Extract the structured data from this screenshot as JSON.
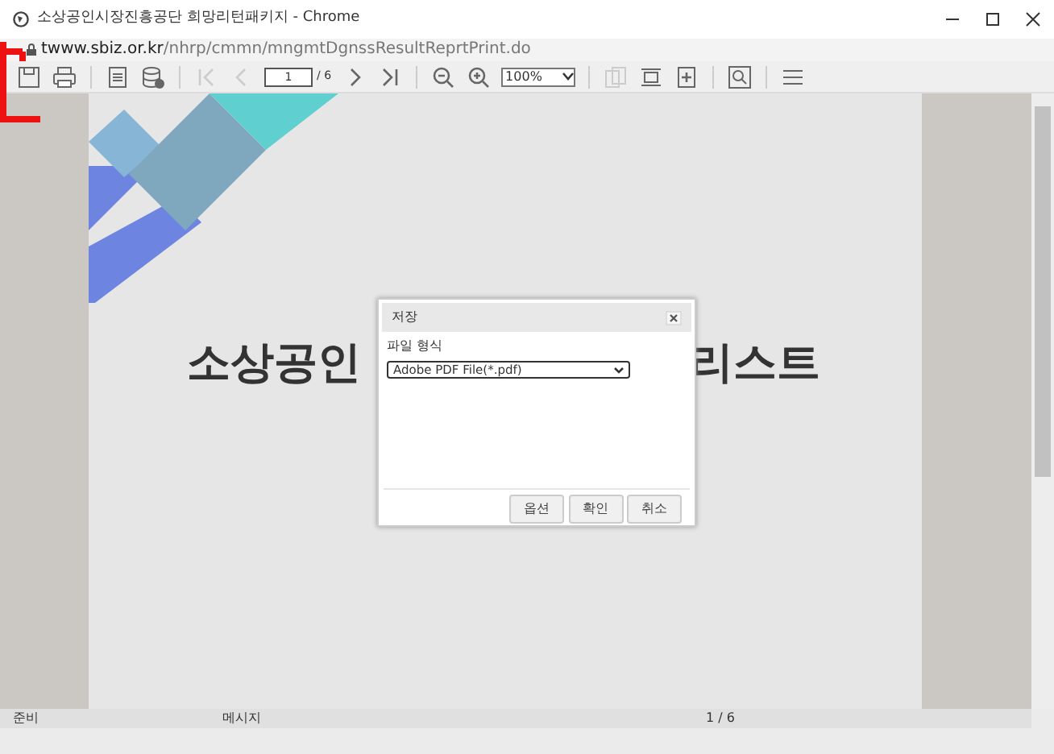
{
  "window": {
    "title": "소상공인시장진흥공단 희망리턴패키지 - Chrome"
  },
  "address": {
    "host": "twww.sbiz.or.kr",
    "path": "/nhrp/cmmn/mngmtDgnssResultReprtPrint.do"
  },
  "toolbar": [
    {
      "kind": "save",
      "disabled": false
    },
    {
      "kind": "print",
      "disabled": false
    },
    {
      "kind": "sep"
    },
    {
      "kind": "setup",
      "disabled": false
    },
    {
      "kind": "export",
      "disabled": false
    },
    {
      "kind": "sep"
    },
    {
      "kind": "first",
      "disabled": true
    },
    {
      "kind": "prev",
      "disabled": true
    },
    {
      "kind": "page",
      "value": "1",
      "total": "/ 6"
    },
    {
      "kind": "next",
      "disabled": false
    },
    {
      "kind": "last",
      "disabled": false
    },
    {
      "kind": "sep"
    },
    {
      "kind": "zoomout",
      "disabled": false
    },
    {
      "kind": "zoomin",
      "disabled": false
    },
    {
      "kind": "zoom",
      "value": "100%"
    },
    {
      "kind": "sep"
    },
    {
      "kind": "copy",
      "disabled": true
    },
    {
      "kind": "fit",
      "disabled": false
    },
    {
      "kind": "addpage",
      "disabled": false
    },
    {
      "kind": "sep"
    },
    {
      "kind": "search",
      "disabled": false
    },
    {
      "kind": "sep"
    },
    {
      "kind": "menu",
      "disabled": false
    }
  ],
  "document": {
    "title_left": "소상공인",
    "title_right": "리스트"
  },
  "dialog": {
    "title": "저장",
    "label": "파일 형식",
    "format": "Adobe PDF File(*.pdf)",
    "buttons": [
      "옵션",
      "확인",
      "취소"
    ]
  },
  "status_bar": [
    "준비",
    "메시지",
    "1 / 6"
  ]
}
